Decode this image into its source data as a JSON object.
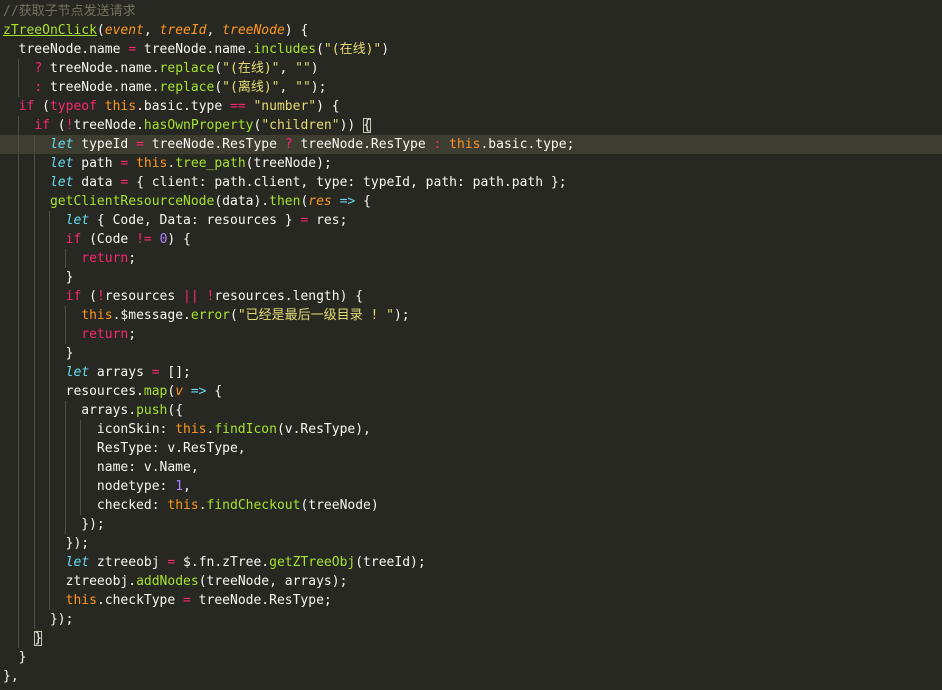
{
  "editor": {
    "lines": [
      [
        [
          "//获取子节点发送请求",
          "com"
        ]
      ],
      [
        [
          "zTreeOnClick",
          "fn-ul"
        ],
        [
          "(",
          "pl"
        ],
        [
          "event",
          "param"
        ],
        [
          ", ",
          "pl"
        ],
        [
          "treeId",
          "param"
        ],
        [
          ", ",
          "pl"
        ],
        [
          "treeNode",
          "param"
        ],
        [
          ") {",
          "pl"
        ]
      ],
      [
        [
          "  treeNode.name ",
          "pl"
        ],
        [
          "=",
          "op"
        ],
        [
          " treeNode.name.",
          "pl"
        ],
        [
          "includes",
          "fn"
        ],
        [
          "(",
          "pl"
        ],
        [
          "\"(在线)\"",
          "str"
        ],
        [
          ")",
          "pl"
        ]
      ],
      [
        [
          "    ",
          "pl"
        ],
        [
          "?",
          "op"
        ],
        [
          " treeNode.name.",
          "pl"
        ],
        [
          "replace",
          "fn"
        ],
        [
          "(",
          "pl"
        ],
        [
          "\"(在线)\"",
          "str"
        ],
        [
          ", ",
          "pl"
        ],
        [
          "\"\"",
          "str"
        ],
        [
          ")",
          "pl"
        ]
      ],
      [
        [
          "    ",
          "pl"
        ],
        [
          ":",
          "op"
        ],
        [
          " treeNode.name.",
          "pl"
        ],
        [
          "replace",
          "fn"
        ],
        [
          "(",
          "pl"
        ],
        [
          "\"(离线)\"",
          "str"
        ],
        [
          ", ",
          "pl"
        ],
        [
          "\"\"",
          "str"
        ],
        [
          ");",
          "pl"
        ]
      ],
      [
        [
          "  ",
          "pl"
        ],
        [
          "if",
          "kw"
        ],
        [
          " (",
          "pl"
        ],
        [
          "typeof",
          "kw"
        ],
        [
          " ",
          "pl"
        ],
        [
          "this",
          "this"
        ],
        [
          ".basic.type ",
          "pl"
        ],
        [
          "==",
          "op"
        ],
        [
          " ",
          "pl"
        ],
        [
          "\"number\"",
          "str"
        ],
        [
          ") {",
          "pl"
        ]
      ],
      [
        [
          "    ",
          "pl"
        ],
        [
          "if",
          "kw"
        ],
        [
          " (",
          "pl"
        ],
        [
          "!",
          "op"
        ],
        [
          "treeNode.",
          "pl"
        ],
        [
          "hasOwnProperty",
          "fn"
        ],
        [
          "(",
          "pl"
        ],
        [
          "\"children\"",
          "str"
        ],
        [
          ")) ",
          "pl"
        ],
        [
          "{",
          "brk"
        ]
      ],
      [
        [
          "      ",
          "pl"
        ],
        [
          "let",
          "sto"
        ],
        [
          " typeId ",
          "pl"
        ],
        [
          "=",
          "op"
        ],
        [
          " treeNode.ResType ",
          "pl"
        ],
        [
          "?",
          "op"
        ],
        [
          " treeNode.ResType ",
          "pl"
        ],
        [
          ":",
          "op"
        ],
        [
          " ",
          "pl"
        ],
        [
          "this",
          "this"
        ],
        [
          ".basic.type;",
          "pl"
        ]
      ],
      [
        [
          "      ",
          "pl"
        ],
        [
          "let",
          "sto"
        ],
        [
          " path ",
          "pl"
        ],
        [
          "=",
          "op"
        ],
        [
          " ",
          "pl"
        ],
        [
          "this",
          "this"
        ],
        [
          ".",
          "pl"
        ],
        [
          "tree_path",
          "fn"
        ],
        [
          "(treeNode);",
          "pl"
        ]
      ],
      [
        [
          "      ",
          "pl"
        ],
        [
          "let",
          "sto"
        ],
        [
          " data ",
          "pl"
        ],
        [
          "=",
          "op"
        ],
        [
          " { client: path.client, type: typeId, path: path.path };",
          "pl"
        ]
      ],
      [
        [
          "      ",
          "pl"
        ],
        [
          "getClientResourceNode",
          "fn"
        ],
        [
          "(data).",
          "pl"
        ],
        [
          "then",
          "fn"
        ],
        [
          "(",
          "pl"
        ],
        [
          "res",
          "param"
        ],
        [
          " ",
          "pl"
        ],
        [
          "=>",
          "sto"
        ],
        [
          " {",
          "pl"
        ]
      ],
      [
        [
          "        ",
          "pl"
        ],
        [
          "let",
          "sto"
        ],
        [
          " { Code, Data: resources } ",
          "pl"
        ],
        [
          "=",
          "op"
        ],
        [
          " res;",
          "pl"
        ]
      ],
      [
        [
          "        ",
          "pl"
        ],
        [
          "if",
          "kw"
        ],
        [
          " (Code ",
          "pl"
        ],
        [
          "!=",
          "op"
        ],
        [
          " ",
          "pl"
        ],
        [
          "0",
          "num"
        ],
        [
          ") {",
          "pl"
        ]
      ],
      [
        [
          "          ",
          "pl"
        ],
        [
          "return",
          "kw"
        ],
        [
          ";",
          "pl"
        ]
      ],
      [
        [
          "        }",
          "pl"
        ]
      ],
      [
        [
          "        ",
          "pl"
        ],
        [
          "if",
          "kw"
        ],
        [
          " (",
          "pl"
        ],
        [
          "!",
          "op"
        ],
        [
          "resources ",
          "pl"
        ],
        [
          "||",
          "op"
        ],
        [
          " ",
          "pl"
        ],
        [
          "!",
          "op"
        ],
        [
          "resources.length) {",
          "pl"
        ]
      ],
      [
        [
          "          ",
          "pl"
        ],
        [
          "this",
          "this"
        ],
        [
          ".$message.",
          "pl"
        ],
        [
          "error",
          "fn"
        ],
        [
          "(",
          "pl"
        ],
        [
          "\"已经是最后一级目录 ! \"",
          "str"
        ],
        [
          ");",
          "pl"
        ]
      ],
      [
        [
          "          ",
          "pl"
        ],
        [
          "return",
          "kw"
        ],
        [
          ";",
          "pl"
        ]
      ],
      [
        [
          "        }",
          "pl"
        ]
      ],
      [
        [
          "        ",
          "pl"
        ],
        [
          "let",
          "sto"
        ],
        [
          " arrays ",
          "pl"
        ],
        [
          "=",
          "op"
        ],
        [
          " [];",
          "pl"
        ]
      ],
      [
        [
          "        resources.",
          "pl"
        ],
        [
          "map",
          "fn"
        ],
        [
          "(",
          "pl"
        ],
        [
          "v",
          "param"
        ],
        [
          " ",
          "pl"
        ],
        [
          "=>",
          "sto"
        ],
        [
          " {",
          "pl"
        ]
      ],
      [
        [
          "          arrays.",
          "pl"
        ],
        [
          "push",
          "fn"
        ],
        [
          "({",
          "pl"
        ]
      ],
      [
        [
          "            iconSkin: ",
          "pl"
        ],
        [
          "this",
          "this"
        ],
        [
          ".",
          "pl"
        ],
        [
          "findIcon",
          "fn"
        ],
        [
          "(v.ResType),",
          "pl"
        ]
      ],
      [
        [
          "            ResType: v.ResType,",
          "pl"
        ]
      ],
      [
        [
          "            name: v.Name,",
          "pl"
        ]
      ],
      [
        [
          "            nodetype: ",
          "pl"
        ],
        [
          "1",
          "num"
        ],
        [
          ",",
          "pl"
        ]
      ],
      [
        [
          "            checked: ",
          "pl"
        ],
        [
          "this",
          "this"
        ],
        [
          ".",
          "pl"
        ],
        [
          "findCheckout",
          "fn"
        ],
        [
          "(treeNode)",
          "pl"
        ]
      ],
      [
        [
          "          });",
          "pl"
        ]
      ],
      [
        [
          "        });",
          "pl"
        ]
      ],
      [
        [
          "        ",
          "pl"
        ],
        [
          "let",
          "sto"
        ],
        [
          " ztreeobj ",
          "pl"
        ],
        [
          "=",
          "op"
        ],
        [
          " $.fn.zTree.",
          "pl"
        ],
        [
          "getZTreeObj",
          "fn"
        ],
        [
          "(treeId);",
          "pl"
        ]
      ],
      [
        [
          "        ztreeobj.",
          "pl"
        ],
        [
          "addNodes",
          "fn"
        ],
        [
          "(treeNode, arrays);",
          "pl"
        ]
      ],
      [
        [
          "        ",
          "pl"
        ],
        [
          "this",
          "this"
        ],
        [
          ".checkType ",
          "pl"
        ],
        [
          "=",
          "op"
        ],
        [
          " treeNode.ResType;",
          "pl"
        ]
      ],
      [
        [
          "      });",
          "pl"
        ]
      ],
      [
        [
          "    ",
          "pl"
        ],
        [
          "}",
          "brk"
        ]
      ],
      [
        [
          "  }",
          "pl"
        ]
      ],
      [
        [
          "},",
          "pl"
        ]
      ]
    ]
  },
  "colors": {
    "background": "#272822",
    "comment": "#75715e",
    "keyword": "#f92672",
    "storage": "#66d9ef",
    "function": "#a6e22e",
    "parameter": "#fd971f",
    "string": "#e6db74",
    "number": "#ae81ff",
    "text": "#f8f8f2"
  }
}
